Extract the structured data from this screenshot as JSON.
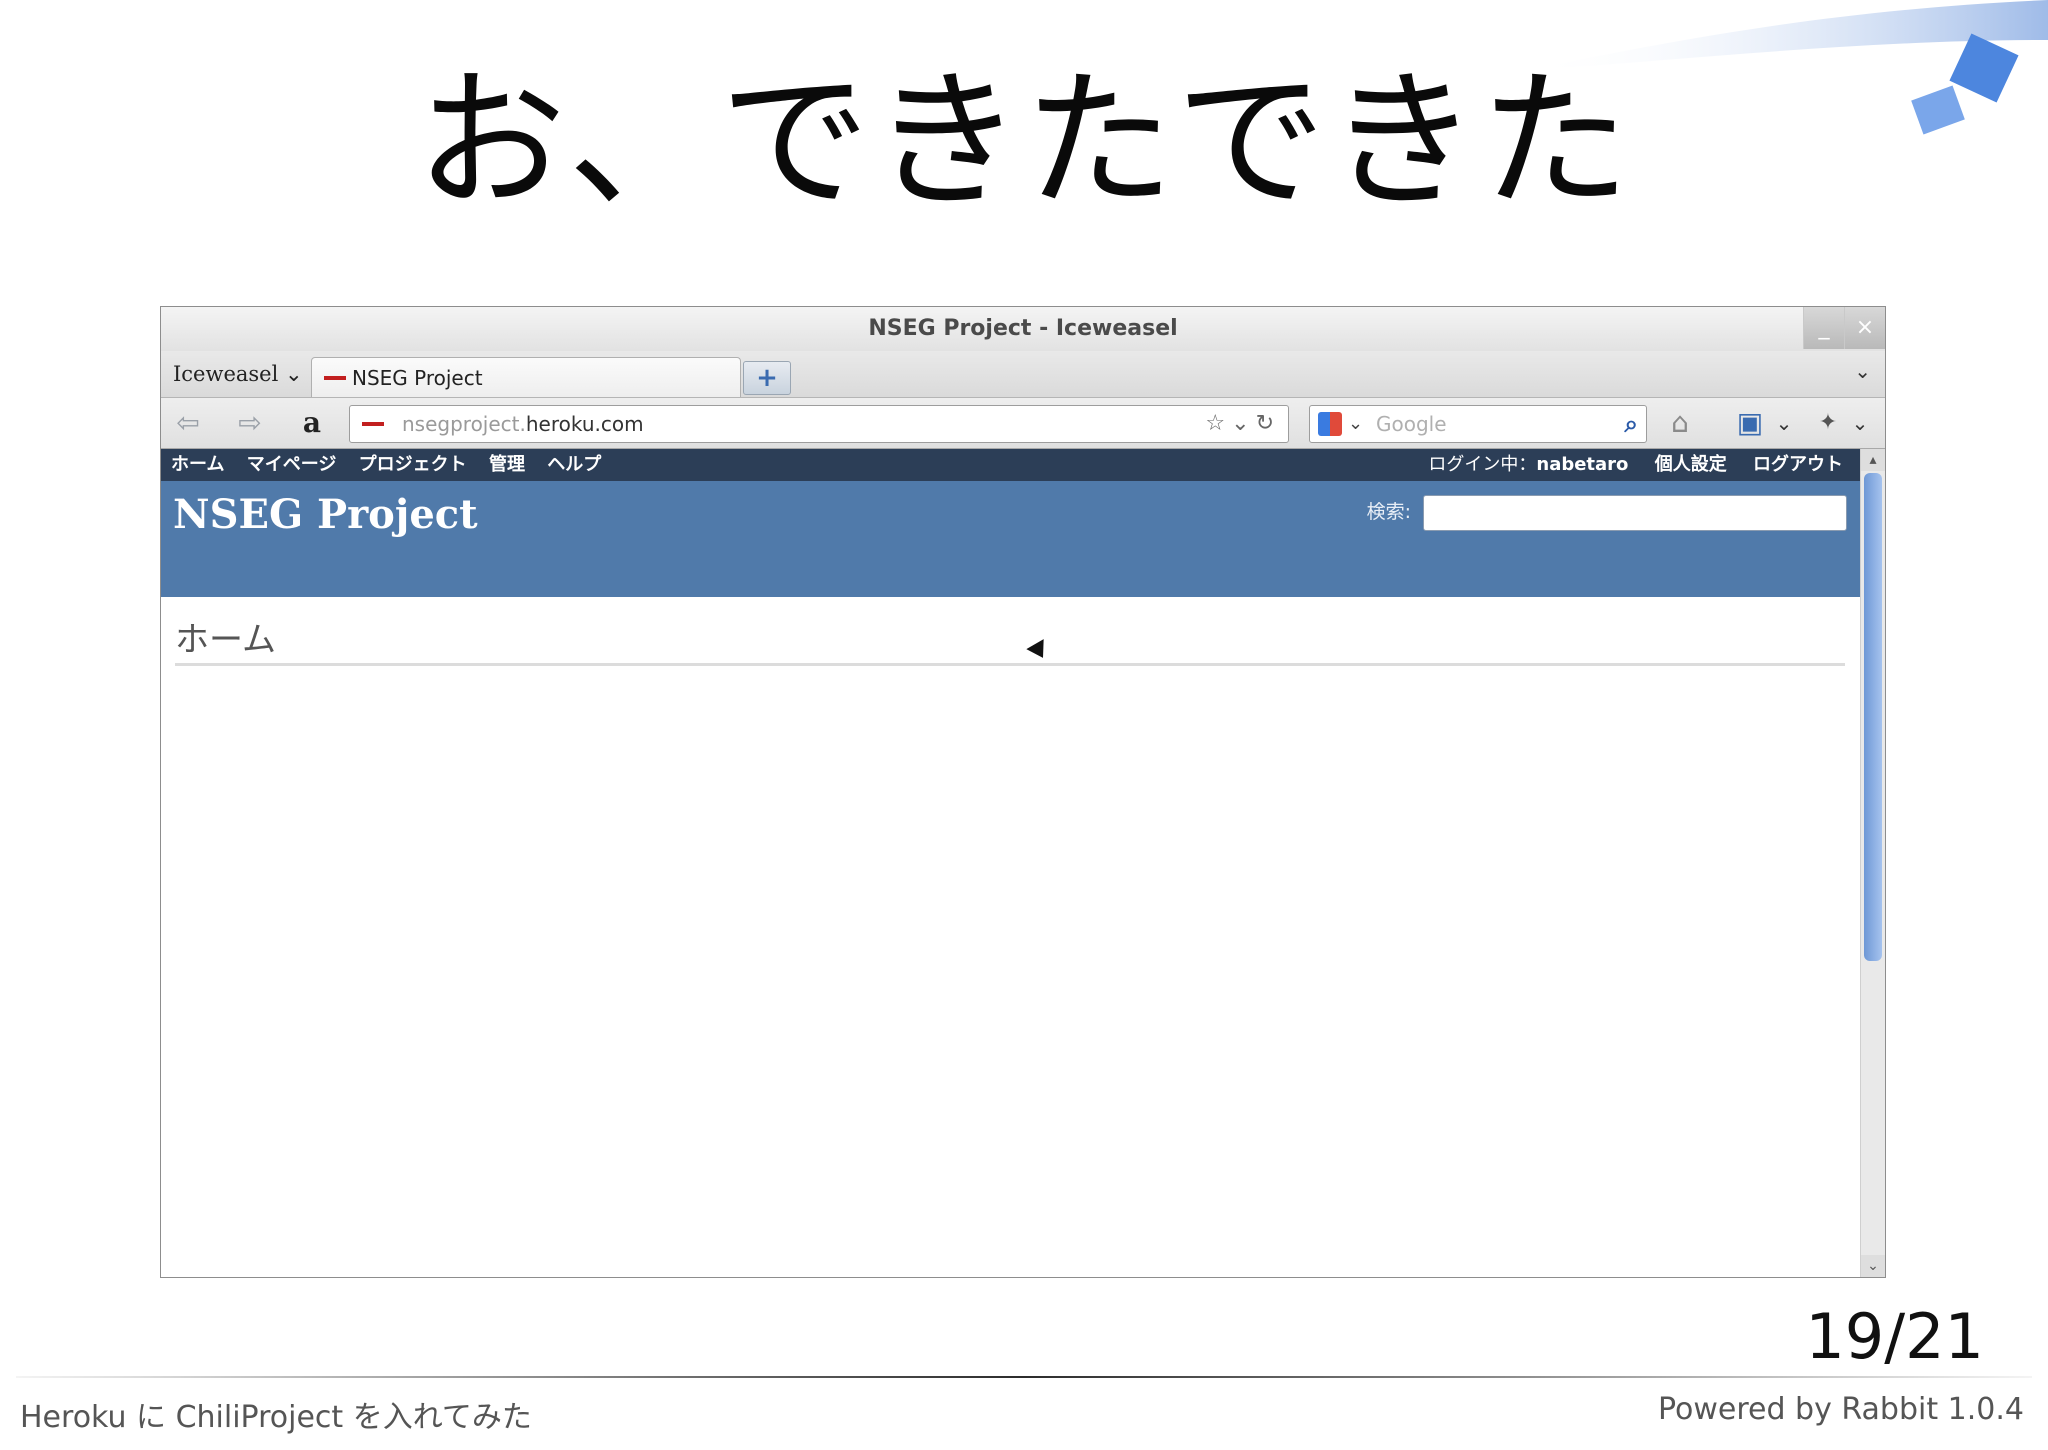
{
  "slide": {
    "title": "お、できたできた",
    "page_number": "19/21",
    "footer_left": "Heroku に ChiliProject を入れてみた",
    "footer_right": "Powered by Rabbit 1.0.4"
  },
  "browser": {
    "window_title": "NSEG Project - Iceweasel",
    "app_menu": "Iceweasel",
    "tab_label": "NSEG Project",
    "url_dim": "nsegproject.",
    "url_host": "heroku.com",
    "search_placeholder": "Google"
  },
  "site": {
    "top_menu": [
      "ホーム",
      "マイページ",
      "プロジェクト",
      "管理",
      "ヘルプ"
    ],
    "logged_in_label": "ログイン中：",
    "username": "nabetaro",
    "my_account": "個人設定",
    "logout": "ログアウト",
    "project_name": "NSEG Project",
    "search_label": "検索:",
    "page_heading": "ホーム"
  },
  "icons": [
    "back-icon",
    "forward-icon",
    "amazon-icon",
    "bookmark-star-icon",
    "reload-icon",
    "search-engine-icon",
    "magnifier-icon",
    "home-icon",
    "bookmarks-icon",
    "addons-icon",
    "new-tab-icon",
    "minimize-icon",
    "close-icon"
  ],
  "colors": {
    "site_header": "#507aaa",
    "top_menu": "#2c3e57",
    "scroll_thumb": "#6e98d6"
  }
}
